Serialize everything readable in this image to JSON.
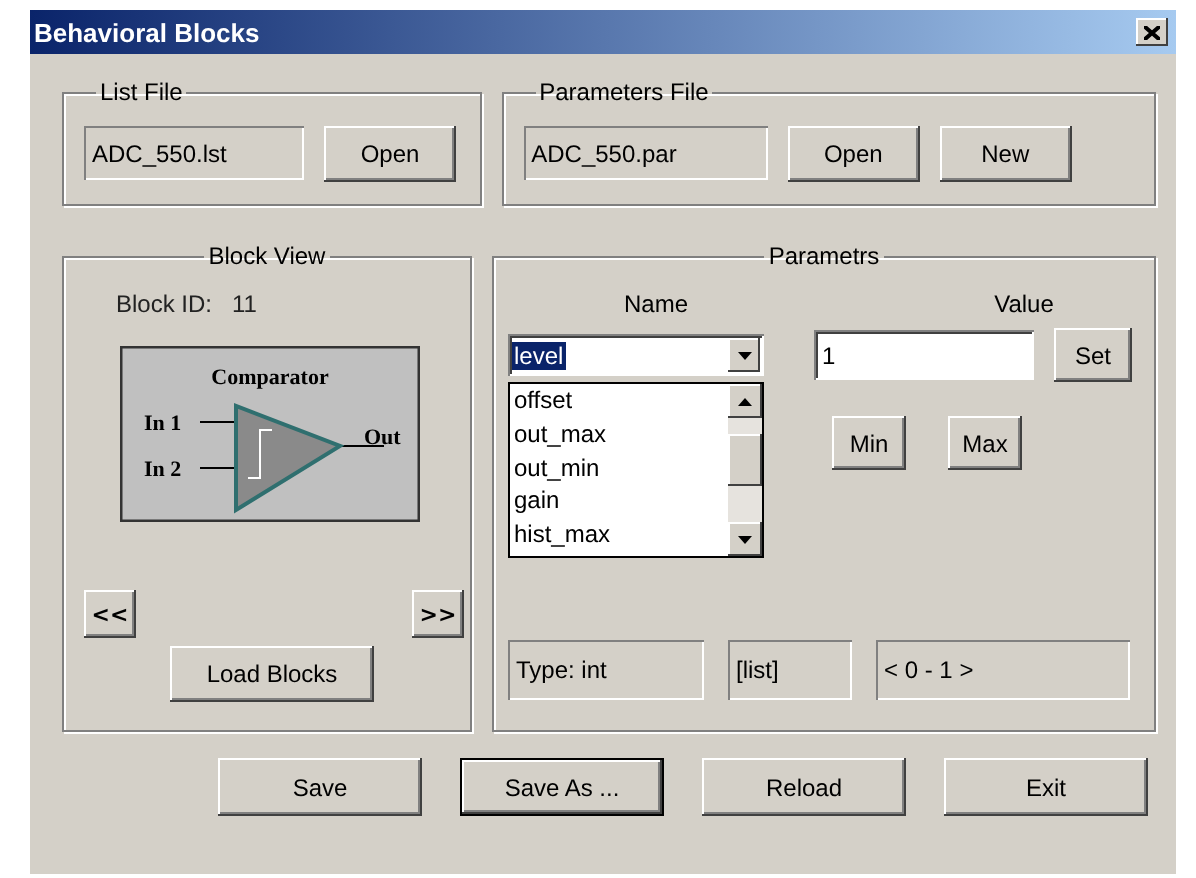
{
  "window": {
    "title": "Behavioral Blocks"
  },
  "list_file": {
    "label": "List File",
    "value": "ADC_550.lst",
    "buttons": [
      "Open"
    ]
  },
  "parameters_file": {
    "label": "Parameters File",
    "value": "ADC_550.par",
    "buttons": [
      "Open",
      "New"
    ]
  },
  "block_view": {
    "label": "Block View",
    "block_id_label": "Block ID:",
    "block_id": "11",
    "diagram": {
      "title": "Comparator",
      "inputs": [
        "In 1",
        "In 2"
      ],
      "output": "Out"
    },
    "prev": "<<",
    "next": ">>",
    "load_button": "Load Blocks"
  },
  "parameters": {
    "label": "Parametrs",
    "name_header": "Name",
    "value_header": "Value",
    "name_combo": {
      "value": "level",
      "options": [
        "offset",
        "out_max",
        "out_min",
        "gain",
        "hist_max"
      ]
    },
    "value_field": "1",
    "set_button": "Set",
    "min_button": "Min",
    "max_button": "Max",
    "type": "Type: int",
    "mode": "[list]",
    "range": "< 0 - 1 >"
  },
  "buttons": [
    {
      "label": "Save",
      "focused": false
    },
    {
      "label": "Save As ...",
      "focused": true
    },
    {
      "label": "Reload",
      "focused": false
    },
    {
      "label": "Exit",
      "focused": false
    }
  ]
}
